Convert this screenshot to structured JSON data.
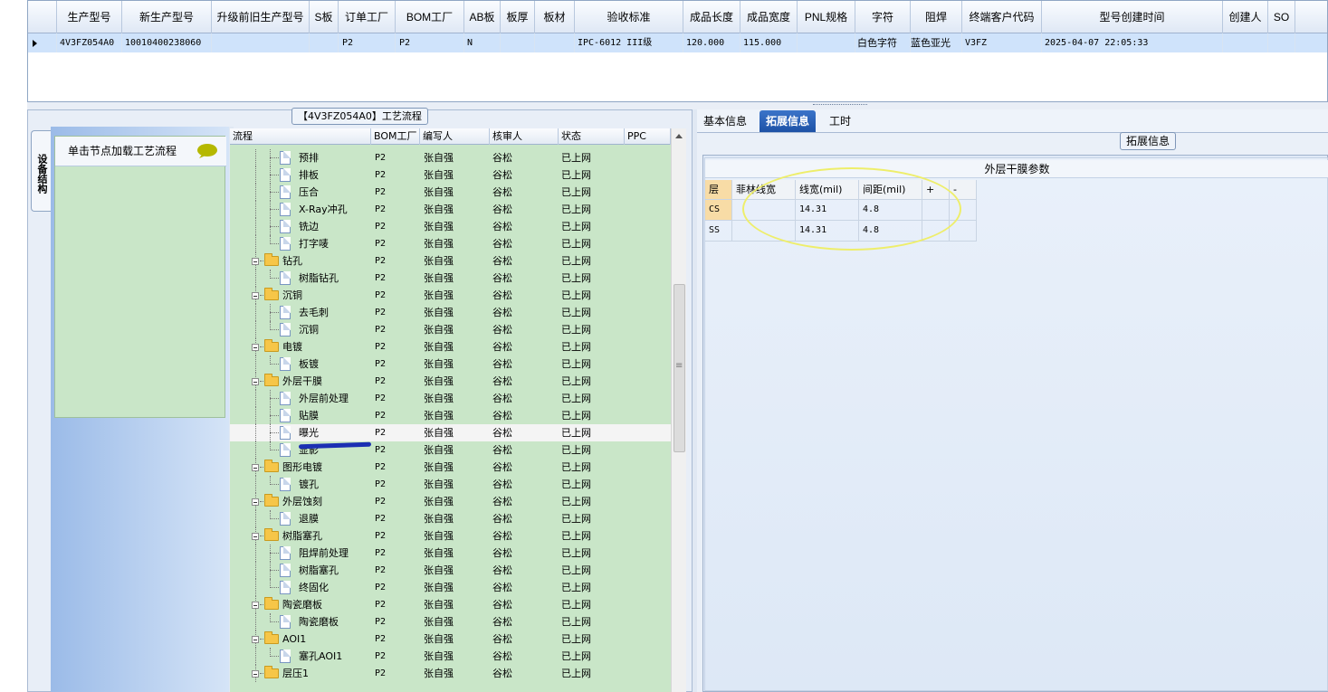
{
  "top_grid": {
    "headers": [
      "生产型号",
      "新生产型号",
      "升级前旧生产型号",
      "S板",
      "订单工厂",
      "BOM工厂",
      "AB板",
      "板厚",
      "板材",
      "验收标准",
      "成品长度",
      "成品宽度",
      "PNL规格",
      "字符",
      "阻焊",
      "终端客户代码",
      "型号创建时间",
      "创建人",
      "SO"
    ],
    "row": {
      "production_model": "4V3FZ054A0",
      "new_production_model": "10010400238060",
      "old_production_model": "",
      "s_board": "",
      "order_factory": "P2",
      "bom_factory": "P2",
      "ab_board": "N",
      "thickness": "",
      "material": "",
      "acceptance_standard": "IPC-6012 III级",
      "finished_length": "120.000",
      "finished_width": "115.000",
      "pnl_spec": "",
      "silkscreen": "白色字符",
      "solder_mask": "蓝色亚光",
      "end_customer_code": "V3FZ",
      "created_time": "2025-04-07 22:05:33",
      "creator": "",
      "so": ""
    }
  },
  "left_panel": {
    "process_title": "【4V3FZ054A0】工艺流程",
    "vertical_tab": "设备结构",
    "equip_hint": "单击节点加载工艺流程"
  },
  "tree": {
    "headers": {
      "name": "流程",
      "bom": "BOM工厂",
      "writer": "编写人",
      "checker": "核审人",
      "status": "状态",
      "ppc": "PPC"
    },
    "rows": [
      {
        "level": 1,
        "type": "doc",
        "name": "预排",
        "bom": "P2",
        "writer": "张自强",
        "checker": "谷松",
        "status": "已上网",
        "last": false
      },
      {
        "level": 1,
        "type": "doc",
        "name": "排板",
        "bom": "P2",
        "writer": "张自强",
        "checker": "谷松",
        "status": "已上网",
        "last": false
      },
      {
        "level": 1,
        "type": "doc",
        "name": "压合",
        "bom": "P2",
        "writer": "张自强",
        "checker": "谷松",
        "status": "已上网",
        "last": false
      },
      {
        "level": 1,
        "type": "doc",
        "name": "X-Ray冲孔",
        "bom": "P2",
        "writer": "张自强",
        "checker": "谷松",
        "status": "已上网",
        "last": false
      },
      {
        "level": 1,
        "type": "doc",
        "name": "铣边",
        "bom": "P2",
        "writer": "张自强",
        "checker": "谷松",
        "status": "已上网",
        "last": false
      },
      {
        "level": 1,
        "type": "doc",
        "name": "打字唛",
        "bom": "P2",
        "writer": "张自强",
        "checker": "谷松",
        "status": "已上网",
        "last": true
      },
      {
        "level": 0,
        "type": "folder",
        "name": "钻孔",
        "bom": "P2",
        "writer": "张自强",
        "checker": "谷松",
        "status": "已上网"
      },
      {
        "level": 1,
        "type": "doc",
        "name": "树脂钻孔",
        "bom": "P2",
        "writer": "张自强",
        "checker": "谷松",
        "status": "已上网",
        "last": true
      },
      {
        "level": 0,
        "type": "folder",
        "name": "沉铜",
        "bom": "P2",
        "writer": "张自强",
        "checker": "谷松",
        "status": "已上网"
      },
      {
        "level": 1,
        "type": "doc",
        "name": "去毛刺",
        "bom": "P2",
        "writer": "张自强",
        "checker": "谷松",
        "status": "已上网",
        "last": false
      },
      {
        "level": 1,
        "type": "doc",
        "name": "沉铜",
        "bom": "P2",
        "writer": "张自强",
        "checker": "谷松",
        "status": "已上网",
        "last": true
      },
      {
        "level": 0,
        "type": "folder",
        "name": "电镀",
        "bom": "P2",
        "writer": "张自强",
        "checker": "谷松",
        "status": "已上网"
      },
      {
        "level": 1,
        "type": "doc",
        "name": "板镀",
        "bom": "P2",
        "writer": "张自强",
        "checker": "谷松",
        "status": "已上网",
        "last": true
      },
      {
        "level": 0,
        "type": "folder",
        "name": "外层干膜",
        "bom": "P2",
        "writer": "张自强",
        "checker": "谷松",
        "status": "已上网"
      },
      {
        "level": 1,
        "type": "doc",
        "name": "外层前处理",
        "bom": "P2",
        "writer": "张自强",
        "checker": "谷松",
        "status": "已上网",
        "last": false
      },
      {
        "level": 1,
        "type": "doc",
        "name": "贴膜",
        "bom": "P2",
        "writer": "张自强",
        "checker": "谷松",
        "status": "已上网",
        "last": false
      },
      {
        "level": 1,
        "type": "doc",
        "name": "曝光",
        "bom": "P2",
        "writer": "张自强",
        "checker": "谷松",
        "status": "已上网",
        "last": false,
        "selected": true
      },
      {
        "level": 1,
        "type": "doc",
        "name": "显影",
        "bom": "P2",
        "writer": "张自强",
        "checker": "谷松",
        "status": "已上网",
        "last": true
      },
      {
        "level": 0,
        "type": "folder",
        "name": "图形电镀",
        "bom": "P2",
        "writer": "张自强",
        "checker": "谷松",
        "status": "已上网"
      },
      {
        "level": 1,
        "type": "doc",
        "name": "镀孔",
        "bom": "P2",
        "writer": "张自强",
        "checker": "谷松",
        "status": "已上网",
        "last": true
      },
      {
        "level": 0,
        "type": "folder",
        "name": "外层蚀刻",
        "bom": "P2",
        "writer": "张自强",
        "checker": "谷松",
        "status": "已上网"
      },
      {
        "level": 1,
        "type": "doc",
        "name": "退膜",
        "bom": "P2",
        "writer": "张自强",
        "checker": "谷松",
        "status": "已上网",
        "last": true
      },
      {
        "level": 0,
        "type": "folder",
        "name": "树脂塞孔",
        "bom": "P2",
        "writer": "张自强",
        "checker": "谷松",
        "status": "已上网"
      },
      {
        "level": 1,
        "type": "doc",
        "name": "阻焊前处理",
        "bom": "P2",
        "writer": "张自强",
        "checker": "谷松",
        "status": "已上网",
        "last": false
      },
      {
        "level": 1,
        "type": "doc",
        "name": "树脂塞孔",
        "bom": "P2",
        "writer": "张自强",
        "checker": "谷松",
        "status": "已上网",
        "last": false
      },
      {
        "level": 1,
        "type": "doc",
        "name": "终固化",
        "bom": "P2",
        "writer": "张自强",
        "checker": "谷松",
        "status": "已上网",
        "last": true
      },
      {
        "level": 0,
        "type": "folder",
        "name": "陶瓷磨板",
        "bom": "P2",
        "writer": "张自强",
        "checker": "谷松",
        "status": "已上网"
      },
      {
        "level": 1,
        "type": "doc",
        "name": "陶瓷磨板",
        "bom": "P2",
        "writer": "张自强",
        "checker": "谷松",
        "status": "已上网",
        "last": true
      },
      {
        "level": 0,
        "type": "folder",
        "name": "AOI1",
        "bom": "P2",
        "writer": "张自强",
        "checker": "谷松",
        "status": "已上网"
      },
      {
        "level": 1,
        "type": "doc",
        "name": "塞孔AOI1",
        "bom": "P2",
        "writer": "张自强",
        "checker": "谷松",
        "status": "已上网",
        "last": true
      },
      {
        "level": 0,
        "type": "folder",
        "name": "层压1",
        "bom": "P2",
        "writer": "张自强",
        "checker": "谷松",
        "status": "已上网"
      }
    ]
  },
  "right_panel": {
    "tabs": [
      {
        "label": "基本信息",
        "active": false
      },
      {
        "label": "拓展信息",
        "active": true
      },
      {
        "label": "工时",
        "active": false
      }
    ],
    "ext_title": "拓展信息",
    "dry_film_title": "外层干膜参数",
    "dry_film_headers": [
      "层",
      "菲林线宽",
      "线宽(mil)",
      "间距(mil)",
      "+",
      "-"
    ],
    "dry_film_rows": [
      {
        "layer": "CS",
        "film_width": "",
        "line_width": "14.31",
        "spacing": "4.8"
      },
      {
        "layer": "SS",
        "film_width": "",
        "line_width": "14.31",
        "spacing": "4.8"
      }
    ]
  },
  "colors": {
    "tree_bg": "#c9e6c8",
    "selected_row": "#cfe3fb",
    "active_tab": "#2a62b8",
    "layer_cell": "#f8dca6",
    "annotation_ellipse": "#eeee6a",
    "annotation_mark": "#1b2fb3"
  },
  "icons": [
    "folder-icon",
    "document-icon",
    "chat-bubble-icon",
    "expand-icon",
    "scroll-up-icon"
  ]
}
